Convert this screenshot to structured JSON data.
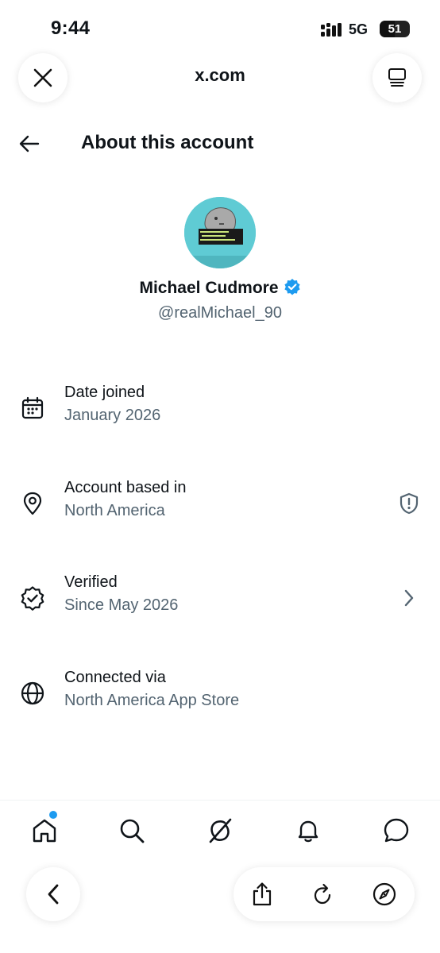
{
  "status_bar": {
    "time": "9:44",
    "network": "5G",
    "network_icon": "5g-uw-indicator",
    "signal_icon": "cellular-signal-icon",
    "battery_level": "51",
    "battery_fraction": 0.51
  },
  "browser": {
    "url": "x.com",
    "close_icon": "close-icon",
    "tabs_icon": "tabs-overview-icon"
  },
  "page": {
    "title": "About this account",
    "back_icon": "back-arrow-icon"
  },
  "profile": {
    "name": "Michael Cudmore",
    "handle": "@realMichael_90",
    "verified": true,
    "verified_icon": "verified-badge-icon",
    "avatar_colors": {
      "background": "#5fcbd4",
      "face": "#a9a9a9"
    }
  },
  "details": [
    {
      "icon": "calendar-icon",
      "label": "Date joined",
      "value": "January 2026",
      "trailing_icon": ""
    },
    {
      "icon": "location-pin-icon",
      "label": "Account based in",
      "value": "North America",
      "trailing_icon": "shield-alert-icon"
    },
    {
      "icon": "verified-check-icon",
      "label": "Verified",
      "value": "Since May 2026",
      "trailing_icon": "chevron-right-icon"
    },
    {
      "icon": "globe-icon",
      "label": "Connected via",
      "value": "North America App Store",
      "trailing_icon": ""
    }
  ],
  "tab_bar": {
    "items": [
      {
        "icon": "home-icon",
        "active": true,
        "has_notification": true
      },
      {
        "icon": "search-icon",
        "active": false
      },
      {
        "icon": "grok-icon",
        "active": false
      },
      {
        "icon": "notifications-bell-icon",
        "active": false
      },
      {
        "icon": "messages-icon",
        "active": false
      }
    ]
  },
  "browser_toolbar": {
    "items": [
      "back-icon",
      "share-icon",
      "reload-icon",
      "compass-icon"
    ]
  },
  "colors": {
    "text_primary": "#0f1419",
    "text_secondary": "#536471",
    "accent": "#1d9bf0",
    "background": "#ffffff"
  }
}
